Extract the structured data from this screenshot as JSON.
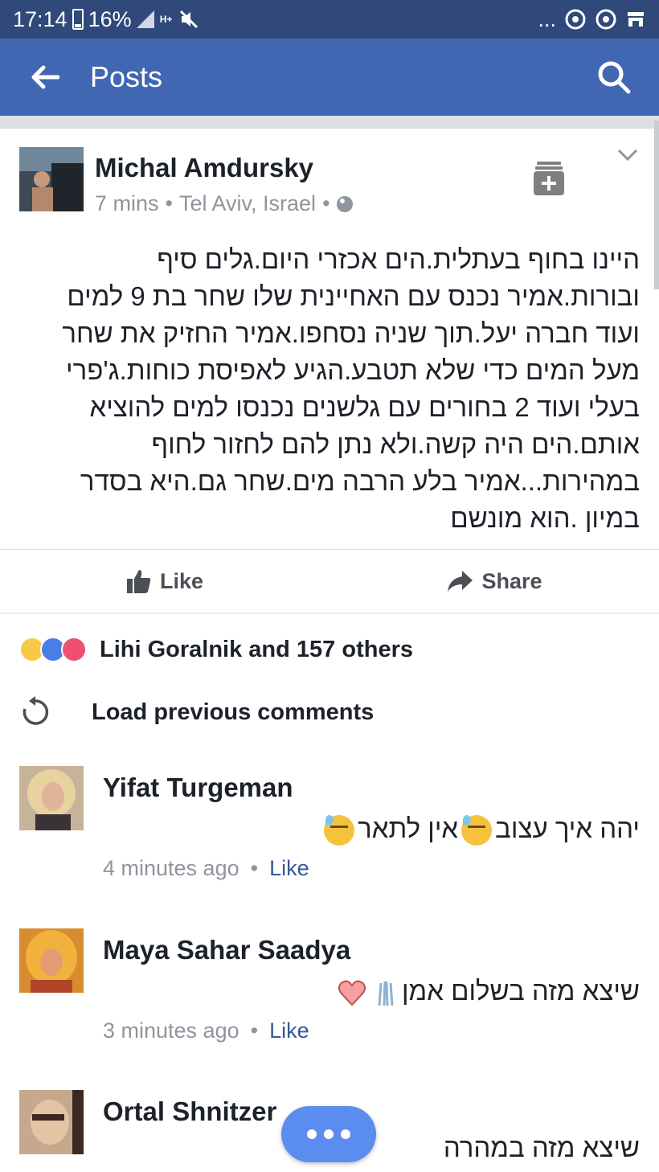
{
  "status_bar": {
    "time": "17:14",
    "battery": "16%",
    "network": "H+",
    "overflow": "..."
  },
  "app_bar": {
    "title": "Posts"
  },
  "post": {
    "author": "Michal Amdursky",
    "time": "7 mins",
    "separator": "•",
    "location": "Tel Aviv, Israel",
    "body": "היינו בחוף בעתלית.הים  אכזרי היום.גלים סיף ובורות.אמיר נכנס עם האחיינית שלו שחר בת 9 למים ועוד חברה יעל.תוך שניה נסחפו.אמיר החזיק את שחר מעל המים כדי שלא תטבע.הגיע לאפיסת כוחות.ג'פרי בעלי ועוד 2 בחורים עם גלשנים נכנסו למים להוציא אותם.הים היה קשה.ולא נתן להם לחזור לחוף במהירות...אמיר  בלע הרבה מים.שחר גם.היא בסדר במיון .הוא מונשם",
    "like_label": "Like",
    "share_label": "Share"
  },
  "reactions": {
    "text": "Lihi Goralnik and 157 others",
    "types": [
      "sad",
      "like",
      "love"
    ]
  },
  "load_previous": "Load previous comments",
  "comments": [
    {
      "name": "Yifat Turgeman",
      "text_part1": "יהה איך עצוב",
      "text_part2": "אין לתאר",
      "time": "4 minutes ago",
      "dot": "•",
      "like": "Like"
    },
    {
      "name": "Maya Sahar Saadya",
      "text": "שיצא מזה בשלום אמן",
      "time": "3 minutes ago",
      "dot": "•",
      "like": "Like"
    },
    {
      "name": "Ortal Shnitzer",
      "text": "שיצא מזה במהרה"
    }
  ],
  "colors": {
    "status_bar": "#30487a",
    "app_bar": "#4267b2",
    "link": "#365899",
    "fab": "#5b8def"
  },
  "icons": [
    "back-arrow-icon",
    "search-icon",
    "globe-icon",
    "save-icon",
    "chevron-down-icon",
    "like-thumb-icon",
    "share-arrow-icon",
    "refresh-icon",
    "more-dots-icon"
  ]
}
